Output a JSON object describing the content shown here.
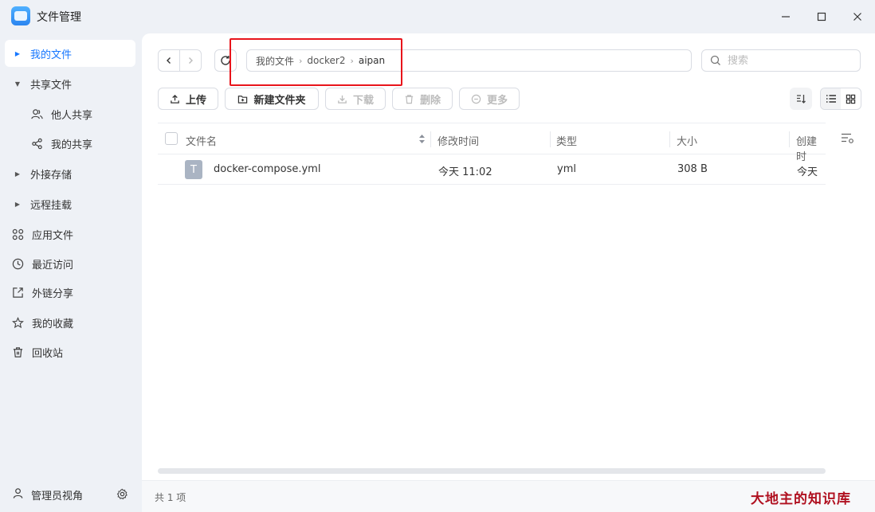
{
  "app": {
    "title": "文件管理",
    "window_controls": [
      "minimize-icon",
      "maximize-icon",
      "close-icon"
    ]
  },
  "sidebar": {
    "items": [
      {
        "label": "我的文件",
        "icon": "caret-right-icon",
        "active": true
      },
      {
        "label": "共享文件",
        "icon": "caret-down-icon"
      },
      {
        "label": "他人共享",
        "icon": "users-icon"
      },
      {
        "label": "我的共享",
        "icon": "share-icon"
      },
      {
        "label": "外接存储",
        "icon": "caret-right-icon"
      },
      {
        "label": "远程挂载",
        "icon": "caret-right-icon"
      },
      {
        "label": "应用文件",
        "icon": "apps-icon"
      },
      {
        "label": "最近访问",
        "icon": "clock-icon"
      },
      {
        "label": "外链分享",
        "icon": "external-link-icon"
      },
      {
        "label": "我的收藏",
        "icon": "star-icon"
      },
      {
        "label": "回收站",
        "icon": "trash-icon"
      }
    ],
    "admin_label": "管理员视角"
  },
  "breadcrumb": {
    "segments": [
      "我的文件",
      "docker2",
      "aipan"
    ]
  },
  "search": {
    "placeholder": "搜索",
    "value": ""
  },
  "toolbar": {
    "upload": "上传",
    "new_folder": "新建文件夹",
    "download": "下载",
    "delete": "删除",
    "more": "更多"
  },
  "table": {
    "columns": [
      "文件名",
      "修改时间",
      "类型",
      "大小",
      "创建时"
    ],
    "rows": [
      {
        "name": "docker-compose.yml",
        "modified": "今天 11:02",
        "type": "yml",
        "size": "308 B",
        "created": "今天"
      }
    ]
  },
  "footer": {
    "count": "共 1 项"
  },
  "watermark": "大地主的知识库",
  "colors": {
    "accent": "#1677ff",
    "highlight_box": "#e8141b",
    "watermark": "#b01020"
  }
}
